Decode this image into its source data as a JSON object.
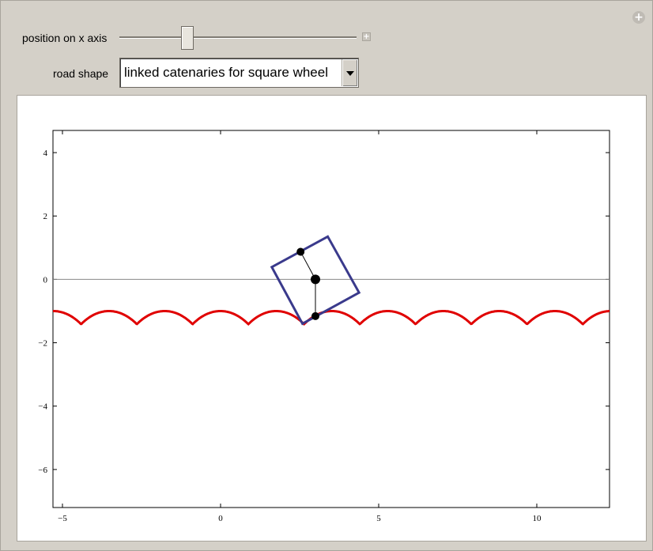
{
  "controls": {
    "position_label": "position on x axis",
    "position_value": 0.46,
    "road_label": "road shape",
    "road_value": "linked catenaries for square wheel"
  },
  "chart_data": {
    "type": "line",
    "xlim": [
      -5.3,
      12.3
    ],
    "ylim": [
      -7.2,
      4.7
    ],
    "x_ticks": [
      "−5",
      "0",
      "5",
      "10"
    ],
    "x_tick_values": [
      -5,
      0,
      5,
      10
    ],
    "y_ticks": [
      "4",
      "2",
      "0",
      "−2",
      "−4",
      "−6"
    ],
    "y_tick_values": [
      4,
      2,
      0,
      -2,
      -4,
      -6
    ],
    "road": {
      "color": "#e00000",
      "arch_period": 1.7627,
      "top_y": -1.0,
      "cusp_y": -1.414,
      "first_cusp_x": -4.41
    },
    "wheel": {
      "color": "#3a3a8c",
      "corners": [
        [
          3.39,
          1.35
        ],
        [
          4.38,
          -0.42
        ],
        [
          2.59,
          -1.4
        ],
        [
          1.62,
          0.39
        ]
      ],
      "center": [
        3.0,
        0.0
      ],
      "point_top": [
        2.53,
        0.87
      ],
      "point_contact": [
        3.0,
        -1.16
      ]
    },
    "axis_line_y": 0,
    "grid": false
  }
}
